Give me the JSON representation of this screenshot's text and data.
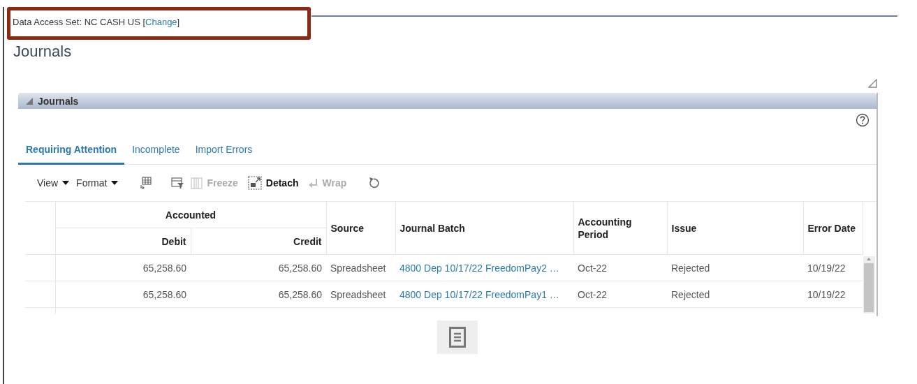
{
  "header": {
    "label": "Data Access Set:",
    "value": "NC CASH US",
    "bracket_open": "[",
    "change_link": "Change",
    "bracket_close": "]",
    "highlighted": true
  },
  "page_title": "Journals",
  "panel": {
    "title": "Journals",
    "expanded": true,
    "tabs": [
      {
        "label": "Requiring Attention",
        "selected": true
      },
      {
        "label": "Incomplete",
        "selected": false
      },
      {
        "label": "Import Errors",
        "selected": false
      }
    ],
    "toolbar": {
      "view_menu": "View",
      "format_menu": "Format",
      "freeze": {
        "label": "Freeze",
        "disabled": true
      },
      "detach": {
        "label": "Detach",
        "disabled": false
      },
      "wrap": {
        "label": "Wrap",
        "disabled": true
      }
    },
    "table": {
      "group_header": "Accounted",
      "columns": [
        {
          "label": "Debit",
          "kind": "number",
          "group": true
        },
        {
          "label": "Credit",
          "kind": "number",
          "group": true
        },
        {
          "label": "Source",
          "kind": "text",
          "group": false
        },
        {
          "label": "Journal Batch",
          "kind": "link",
          "group": false
        },
        {
          "label": "Accounting Period",
          "kind": "text",
          "group": false
        },
        {
          "label": "Issue",
          "kind": "text",
          "group": false
        },
        {
          "label": "Error Date",
          "kind": "text",
          "group": false
        }
      ],
      "rows": [
        [
          "65,258.60",
          "65,258.60",
          "Spreadsheet",
          "4800 Dep 10/17/22 FreedomPay2 …",
          "Oct-22",
          "Rejected",
          "10/19/22"
        ],
        [
          "65,258.60",
          "65,258.60",
          "Spreadsheet",
          "4800 Dep 10/17/22 FreedomPay1 …",
          "Oct-22",
          "Rejected",
          "10/19/22"
        ]
      ]
    }
  }
}
